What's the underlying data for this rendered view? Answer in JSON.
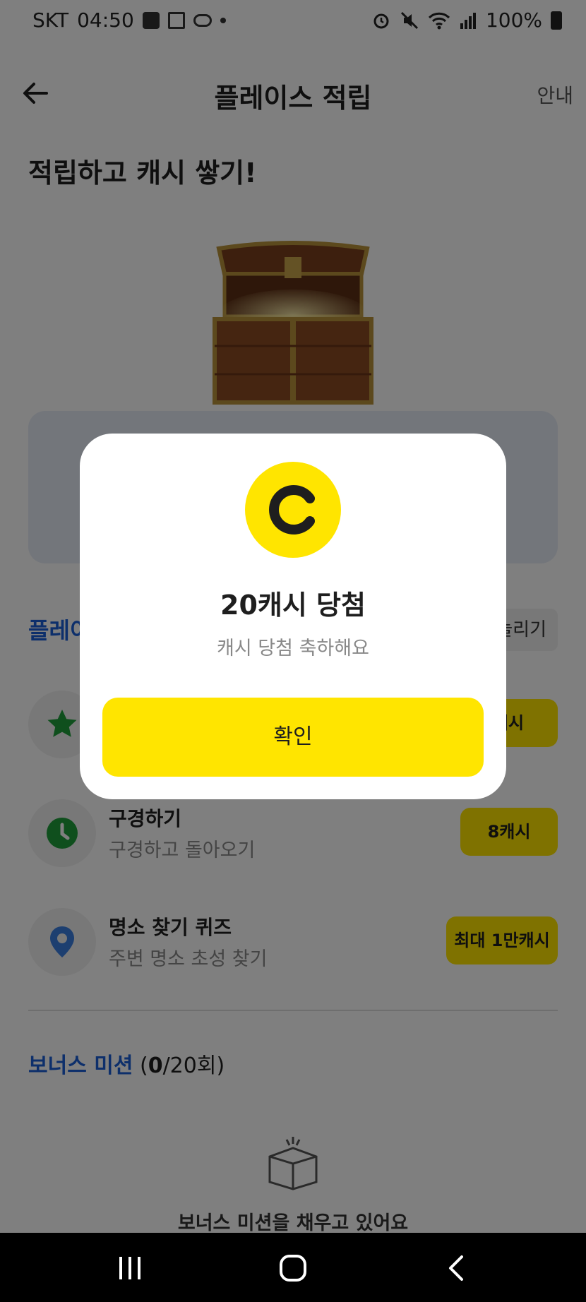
{
  "status_bar": {
    "carrier": "SKT",
    "time": "04:50",
    "battery": "100%"
  },
  "header": {
    "title": "플레이스 적립",
    "help_label": "안내"
  },
  "headline": "적립하고 캐시 쌓기!",
  "section": {
    "title_partial": "플레이",
    "more_partial": "늘리기"
  },
  "missions": [
    {
      "icon": "star-icon",
      "title": "",
      "subtitle": "",
      "reward": "캐시"
    },
    {
      "icon": "clock-icon",
      "title": "구경하기",
      "subtitle": "구경하고 돌아오기",
      "reward": "8캐시"
    },
    {
      "icon": "location-pin-icon",
      "title": "명소 찾기 퀴즈",
      "subtitle": "주변 명소 초성 찾기",
      "reward": "최대 1만캐시"
    }
  ],
  "bonus": {
    "title": "보너스 미션",
    "count_current": "0",
    "count_rest": "/20회)",
    "count_open": " (",
    "empty_text": "보너스 미션을 채우고 있어요"
  },
  "modal": {
    "title": "20캐시 당첨",
    "subtitle": "캐시 당첨 축하해요",
    "confirm_label": "확인"
  },
  "colors": {
    "accent_yellow": "#ffe500",
    "brand_blue": "#1a5fd6",
    "star_green": "#1e9e3a",
    "pin_blue": "#3b7fe0"
  }
}
